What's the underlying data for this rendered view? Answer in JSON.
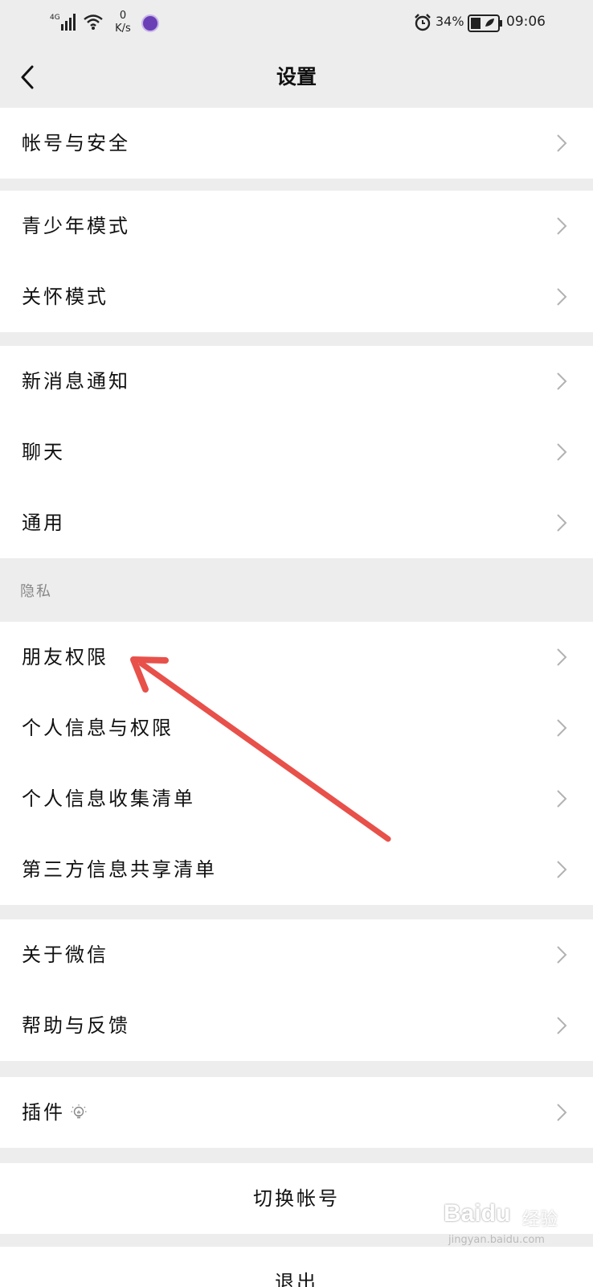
{
  "status_bar": {
    "network": "4G",
    "speed_value": "0",
    "speed_unit": "K/s",
    "battery_percent": "34%",
    "time": "09:06"
  },
  "nav": {
    "title": "设置"
  },
  "groups": [
    {
      "items": [
        "帐号与安全"
      ]
    },
    {
      "items": [
        "青少年模式",
        "关怀模式"
      ]
    },
    {
      "items": [
        "新消息通知",
        "聊天",
        "通用"
      ]
    },
    {
      "header": "隐私",
      "items": [
        "朋友权限",
        "个人信息与权限",
        "个人信息收集清单",
        "第三方信息共享清单"
      ]
    },
    {
      "items": [
        "关于微信",
        "帮助与反馈"
      ]
    },
    {
      "items": [
        "插件"
      ]
    }
  ],
  "actions": {
    "switch_account": "切换帐号",
    "logout": "退出"
  },
  "watermark": {
    "logo": "Baidu",
    "sub": "经验",
    "url": "jingyan.baidu.com"
  },
  "colors": {
    "background": "#ededed",
    "annotation_arrow": "#e8504a"
  }
}
